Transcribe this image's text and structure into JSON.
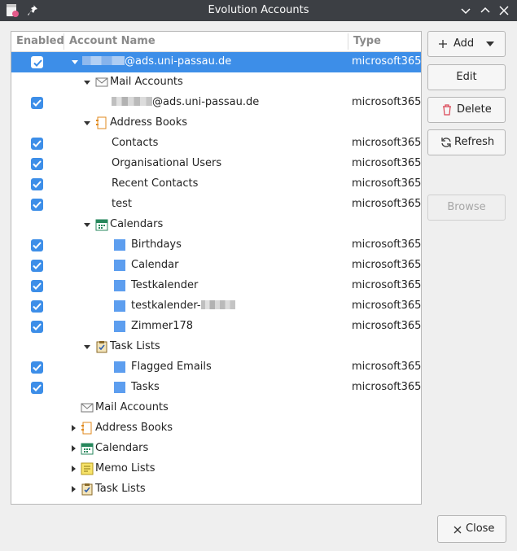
{
  "window": {
    "title": "Evolution Accounts"
  },
  "columns": {
    "enabled": "Enabled",
    "name": "Account Name",
    "type": "Type"
  },
  "rows": [
    {
      "label": "@ads.uni-passau.de",
      "type": "microsoft365"
    },
    {
      "label": "Mail Accounts",
      "icon": "mail-icon"
    },
    {
      "label": "@ads.uni-passau.de",
      "type": "microsoft365"
    },
    {
      "label": "Address Books",
      "icon": "address-book-icon"
    },
    {
      "label": "Contacts",
      "type": "microsoft365"
    },
    {
      "label": "Organisational Users",
      "type": "microsoft365"
    },
    {
      "label": "Recent Contacts",
      "type": "microsoft365"
    },
    {
      "label": "test",
      "type": "microsoft365"
    },
    {
      "label": "Calendars",
      "icon": "calendar-icon"
    },
    {
      "label": "Birthdays",
      "type": "microsoft365"
    },
    {
      "label": "Calendar",
      "type": "microsoft365"
    },
    {
      "label": "Testkalender",
      "type": "microsoft365"
    },
    {
      "label": "testkalender-",
      "type": "microsoft365"
    },
    {
      "label": "Zimmer178",
      "type": "microsoft365"
    },
    {
      "label": "Task Lists",
      "icon": "task-list-icon"
    },
    {
      "label": "Flagged Emails",
      "type": "microsoft365"
    },
    {
      "label": "Tasks",
      "type": "microsoft365"
    },
    {
      "label": "Mail Accounts",
      "icon": "mail-icon"
    },
    {
      "label": "Address Books",
      "icon": "address-book-icon"
    },
    {
      "label": "Calendars",
      "icon": "calendar-icon"
    },
    {
      "label": "Memo Lists",
      "icon": "memo-list-icon"
    },
    {
      "label": "Task Lists",
      "icon": "task-list-icon"
    }
  ],
  "buttons": {
    "add": "Add",
    "edit": "Edit",
    "delete": "Delete",
    "refresh": "Refresh",
    "browse": "Browse",
    "close": "Close"
  },
  "colors": {
    "accent": "#3d8ee8",
    "source": "#5d9eef",
    "titlebar": "#3c3f44"
  }
}
